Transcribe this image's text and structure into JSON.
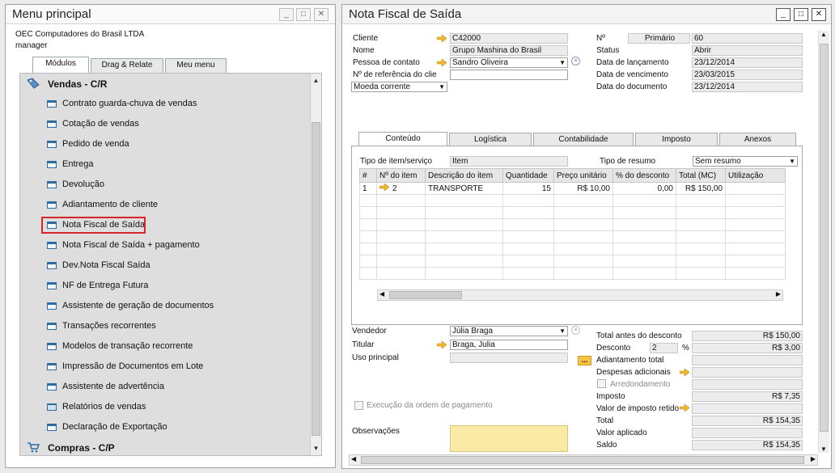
{
  "menu": {
    "title": "Menu principal",
    "company": "OEC Computadores do Brasil LTDA",
    "user": "manager",
    "tabs": [
      "Módulos",
      "Drag & Relate",
      "Meu menu"
    ],
    "section_sales": "Vendas - C/R",
    "items": [
      "Contrato guarda-chuva de vendas",
      "Cotação de vendas",
      "Pedido de venda",
      "Entrega",
      "Devolução",
      "Adiantamento de cliente",
      "Nota Fiscal de Saída",
      "Nota Fiscal de Saída + pagamento",
      "Dev.Nota Fiscal Saída",
      "NF de Entrega Futura",
      "Assistente de geração de documentos",
      "Transações recorrentes",
      "Modelos de transação recorrente",
      "Impressão de Documentos em Lote",
      "Assistente de advertência",
      "Relatórios de vendas",
      "Declaração de Exportação"
    ],
    "section_purchases": "Compras - C/P",
    "accent_color": "#d6262a"
  },
  "doc": {
    "title": "Nota Fiscal de Saída",
    "header_left": {
      "cliente_label": "Cliente",
      "cliente_value": "C42000",
      "nome_label": "Nome",
      "nome_value": "Grupo Mashina do Brasil",
      "contato_label": "Pessoa de contato",
      "contato_value": "Sandro Oliveira",
      "ref_label": "Nº de referência do clie",
      "ref_value": "",
      "moeda_value": "Moeda corrente"
    },
    "header_right": {
      "no_label": "Nº",
      "serie_value": "Primário",
      "no_value": "60",
      "status_label": "Status",
      "status_value": "Abrir",
      "lanc_label": "Data de lançamento",
      "lanc_value": "23/12/2014",
      "venc_label": "Data de vencimento",
      "venc_value": "23/03/2015",
      "docdate_label": "Data do documento",
      "docdate_value": "23/12/2014"
    },
    "tabs": [
      "Conteúdo",
      "Logística",
      "Contabilidade",
      "Imposto",
      "Anexos"
    ],
    "tipo_item_label": "Tipo de item/serviço",
    "tipo_item_value": "Item",
    "tipo_resumo_label": "Tipo de resumo",
    "tipo_resumo_value": "Sem resumo",
    "columns": [
      "#",
      "Nº do item",
      "Descrição do item",
      "Quantidade",
      "Preço unitário",
      "% do desconto",
      "Total (MC)",
      "Utilização"
    ],
    "rows": [
      {
        "n": "1",
        "item": "2",
        "desc": "TRANSPORTE",
        "qty": "15",
        "price": "R$ 10,00",
        "disc": "0,00",
        "total": "R$ 150,00",
        "util": ""
      }
    ],
    "footer_left": {
      "vendedor_label": "Vendedor",
      "vendedor_value": "Júlia Braga",
      "titular_label": "Titular",
      "titular_value": "Braga, Julia",
      "uso_label": "Uso principal",
      "uso_value": "",
      "exec_label": "Execução da ordem de pagamento",
      "obs_label": "Observações"
    },
    "footer_right": {
      "total_antes_label": "Total antes do desconto",
      "total_antes_value": "R$ 150,00",
      "desconto_label": "Desconto",
      "desconto_pct": "2",
      "pct_sign": "%",
      "desconto_value": "R$ 3,00",
      "adiant_label": "Adiantamento total",
      "adiant_btn": "...",
      "despesas_label": "Despesas adicionais",
      "arred_label": "Arredondamento",
      "imposto_label": "Imposto",
      "imposto_value": "R$ 7,35",
      "retido_label": "Valor de imposto retido",
      "total_label": "Total",
      "total_value": "R$ 154,35",
      "aplicado_label": "Valor aplicado",
      "saldo_label": "Saldo",
      "saldo_value": "R$ 154,35"
    }
  }
}
